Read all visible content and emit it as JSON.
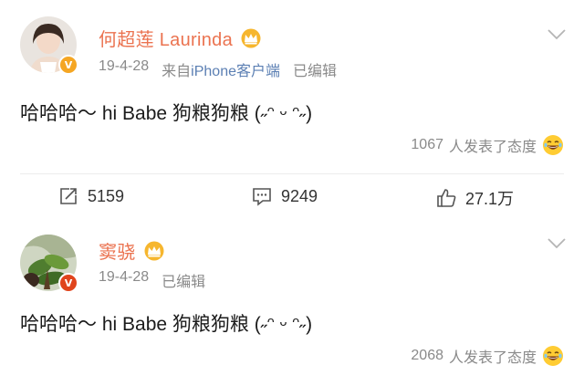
{
  "posts": [
    {
      "username": "何超莲 Laurinda",
      "date": "19-4-28",
      "client_prefix": "来自",
      "client_name": "iPhone客户端",
      "edited": "已编辑",
      "content": "哈哈哈～ hi Babe 狗粮狗粮 (˶ᵔ ᵕ ᵔ˶)",
      "reaction_count": "1067",
      "reaction_text": "人发表了态度",
      "actions": {
        "repost": "5159",
        "comment": "9249",
        "like": "27.1万"
      }
    },
    {
      "username": "窦骁",
      "date": "19-4-28",
      "edited": "已编辑",
      "content": "哈哈哈～ hi Babe 狗粮狗粮 (˶ᵔ ᵕ ᵔ˶)",
      "reaction_count": "2068",
      "reaction_text": "人发表了态度"
    }
  ],
  "colors": {
    "username": "#eb7350",
    "meta": "#8a8a8a",
    "client_link": "#5b7fb3",
    "gold_badge": "#f5a623",
    "red_badge": "#e0441c"
  },
  "icons": [
    "avatar",
    "verified-badge-icon",
    "crown-icon",
    "chevron-down-icon",
    "laugh-emoji-icon",
    "repost-icon",
    "comment-icon",
    "like-icon"
  ]
}
